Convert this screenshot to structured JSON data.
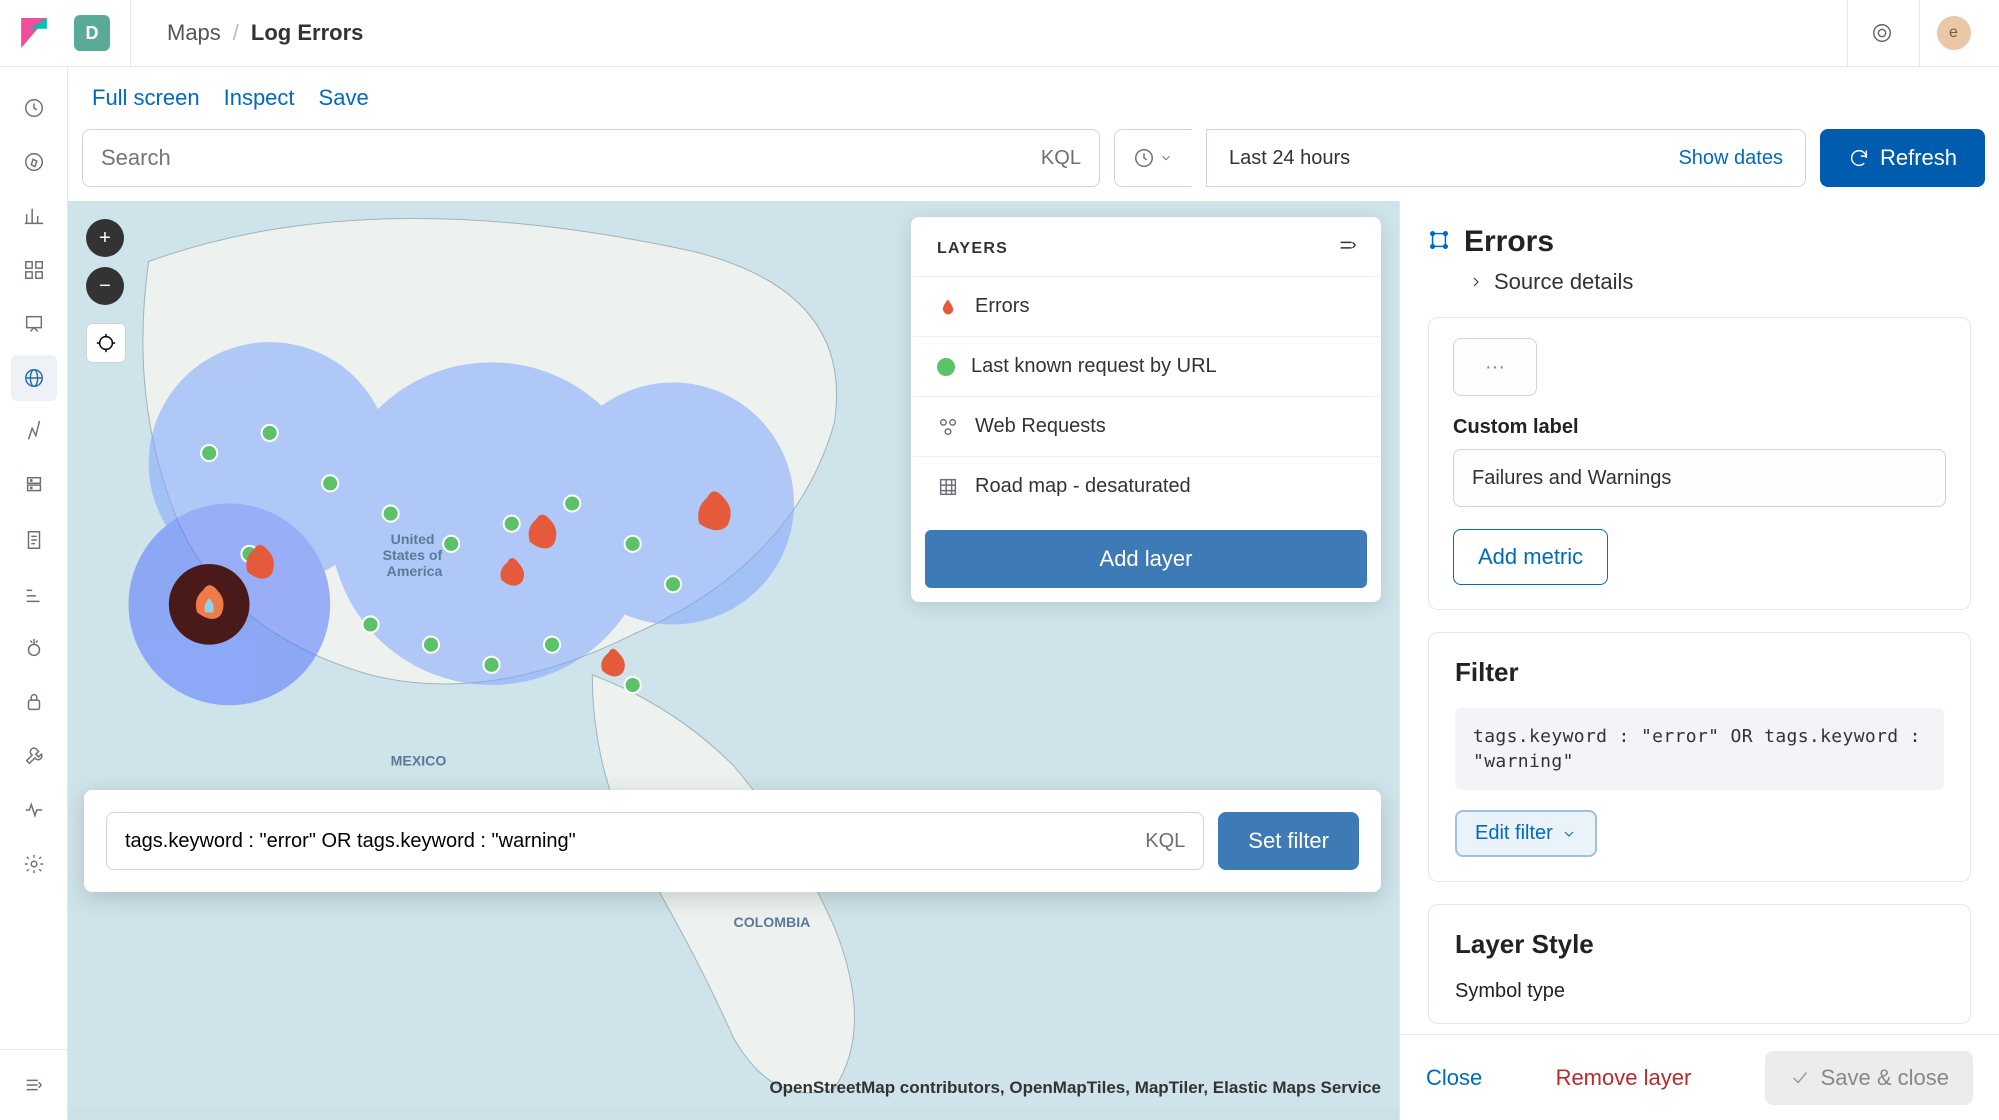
{
  "header": {
    "space_letter": "D",
    "breadcrumb": [
      "Maps",
      "Log Errors"
    ],
    "avatar_letter": "e"
  },
  "toolbar": {
    "full_screen": "Full screen",
    "inspect": "Inspect",
    "save": "Save"
  },
  "query": {
    "placeholder": "Search",
    "kql": "KQL",
    "timerange": "Last 24 hours",
    "show_dates": "Show dates",
    "refresh": "Refresh"
  },
  "layers_panel": {
    "title": "LAYERS",
    "items": [
      {
        "icon": "fire-icon",
        "label": "Errors"
      },
      {
        "icon": "green-dot-icon",
        "label": "Last known request by URL"
      },
      {
        "icon": "cluster-icon",
        "label": "Web Requests"
      },
      {
        "icon": "grid-icon",
        "label": "Road map - desaturated"
      }
    ],
    "add_layer": "Add layer"
  },
  "filter_popover": {
    "value": "tags.keyword : \"error\" OR tags.keyword : \"warning\"",
    "kql": "KQL",
    "set_filter": "Set filter"
  },
  "side_panel": {
    "title": "Errors",
    "source_details": "Source details",
    "custom_label_label": "Custom label",
    "custom_label_value": "Failures and Warnings",
    "add_metric": "Add metric",
    "filter": {
      "heading": "Filter",
      "expression": "tags.keyword : \"error\" OR tags.keyword : \"warning\"",
      "edit": "Edit filter"
    },
    "layer_style": {
      "heading": "Layer Style",
      "symbol_type_label": "Symbol type"
    },
    "footer": {
      "close": "Close",
      "remove": "Remove layer",
      "save_close": "Save & close"
    }
  },
  "map": {
    "credits": "OpenStreetMap contributors, OpenMapTiles, MapTiler, Elastic Maps Service"
  }
}
